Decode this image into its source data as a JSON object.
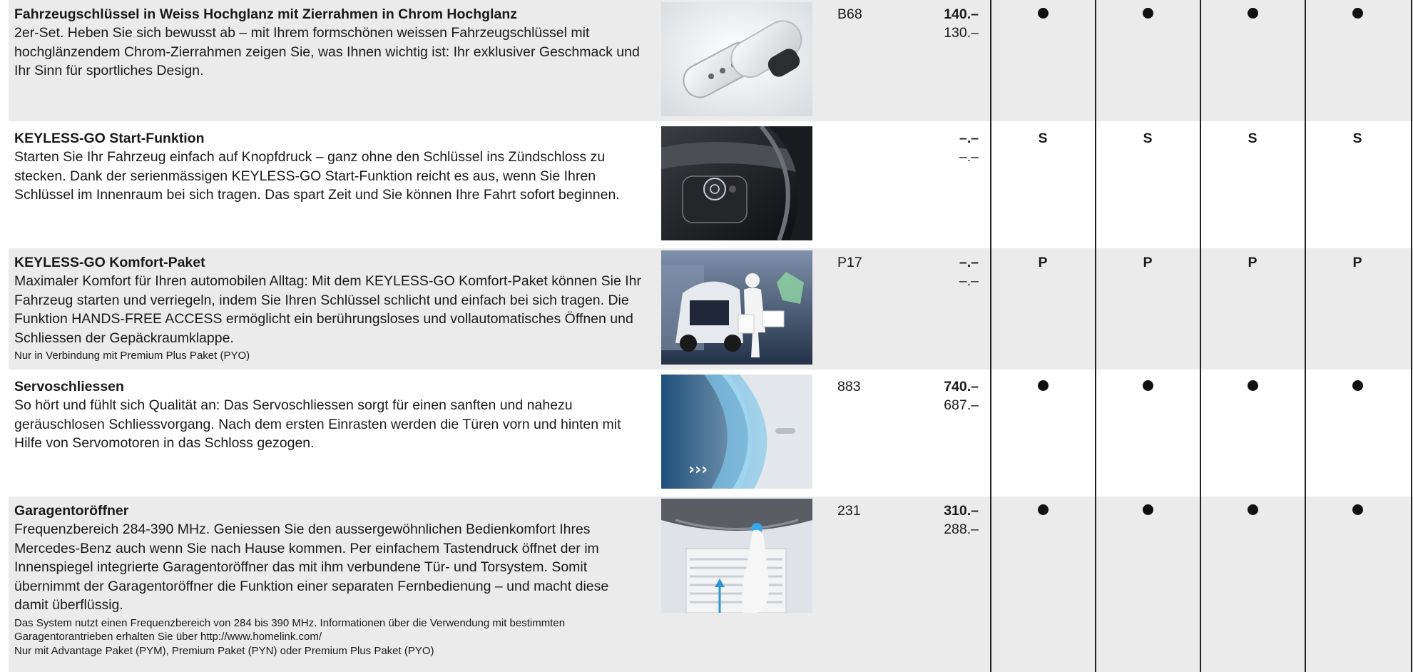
{
  "rows": [
    {
      "title": "Fahrzeugschlüssel in Weiss Hochglanz mit Zierrahmen in Chrom Hochglanz",
      "desc": "2er-Set. Heben Sie sich bewusst ab – mit Ihrem formschönen weissen Fahrzeugschlüssel mit hochglänzendem Chrom-Zierrahmen zeigen Sie, was Ihnen wichtig ist: Ihr exklusiver Geschmack und Ihr Sinn für sportliches Design.",
      "notes": [],
      "code": "B68",
      "price_main": "140.–",
      "price_sub": "130.–",
      "cells": [
        "dot",
        "dot",
        "dot",
        "dot"
      ],
      "image": "white-car-keys"
    },
    {
      "title": "KEYLESS-GO Start-Funktion",
      "desc": "Starten Sie Ihr Fahrzeug einfach auf Knopfdruck – ganz ohne den Schlüssel ins Zündschloss zu stecken. Dank der serienmässigen KEYLESS-GO Start-Funktion reicht es aus, wenn Sie Ihren Schlüssel im Innenraum bei sich tragen. Das spart Zeit und Sie können Ihre Fahrt sofort beginnen.",
      "notes": [],
      "code": "",
      "price_main": "–.–",
      "price_sub": "–.–",
      "cells": [
        "S",
        "S",
        "S",
        "S"
      ],
      "image": "start-button"
    },
    {
      "title": "KEYLESS-GO Komfort-Paket",
      "desc": "Maximaler Komfort für Ihren automobilen Alltag: Mit dem KEYLESS-GO Komfort-Paket können Sie Ihr Fahrzeug starten und verriegeln, indem Sie Ihren Schlüssel schlicht und einfach bei sich tragen. Die Funktion HANDS-FREE ACCESS ermöglicht ein berührungsloses und vollautomatisches Öffnen und Schliessen der Gepäckraumklappe.",
      "notes": [
        "Nur in Verbindung mit Premium Plus Paket (PYO)"
      ],
      "code": "P17",
      "price_main": "–.–",
      "price_sub": "–.–",
      "cells": [
        "P",
        "P",
        "P",
        "P"
      ],
      "image": "hands-free-access"
    },
    {
      "title": "Servoschliessen",
      "desc": "So hört und fühlt sich Qualität an: Das Servoschliessen sorgt für einen sanften und nahezu geräuschlosen Schliessvorgang. Nach dem ersten Einrasten werden die Türen vorn und hinten mit Hilfe von Servomotoren in das Schloss gezogen.",
      "notes": [],
      "code": "883",
      "price_main": "740.–",
      "price_sub": "687.–",
      "cells": [
        "dot",
        "dot",
        "dot",
        "dot"
      ],
      "image": "door-closing"
    },
    {
      "title": "Garagentoröffner",
      "desc": "Frequenzbereich 284-390 MHz. Geniessen Sie den aussergewöhnlichen Bedienkomfort Ihres Mercedes-Benz auch wenn Sie nach Hause kommen. Per einfachem Tastendruck öffnet der im Innenspiegel integrierte Garagentoröffner das mit ihm verbundene Tür- und Torsystem. Somit übernimmt der Garagentoröffner die Funktion einer separaten Fernbedienung – und macht diese damit überflüssig.",
      "notes": [
        "Das System nutzt einen Frequenzbereich von 284 bis 390 MHz. Informationen über die Verwendung mit bestimmten Garagentorantrieben erhalten Sie über http://www.homelink.com/",
        "Nur mit Advantage Paket (PYM), Premium Paket (PYN) oder Premium Plus Paket (PYO)"
      ],
      "code": "231",
      "price_main": "310.–",
      "price_sub": "288.–",
      "cells": [
        "dot",
        "dot",
        "dot",
        "dot"
      ],
      "image": "garage-opener"
    }
  ]
}
